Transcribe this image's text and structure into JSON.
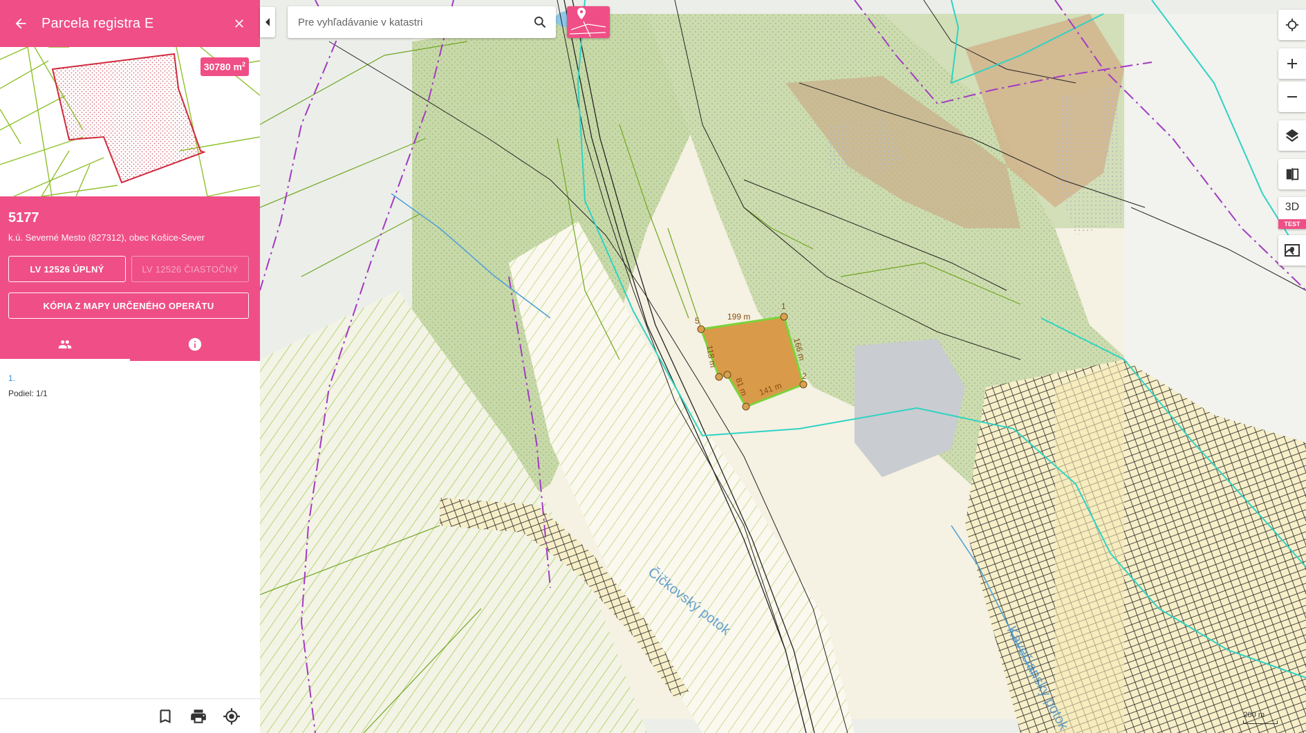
{
  "sidebar": {
    "title": "Parcela registra E",
    "area_value": "30780 m",
    "area_unit_sup": "2",
    "parcel_number": "5177",
    "location": "k.ú. Severné Mesto (827312), obec Košice-Sever",
    "btn_full": "LV 12526 ÚPLNÝ",
    "btn_partial": "LV 12526 ČIASTOČNÝ",
    "btn_copy": "KÓPIA Z MAPY URČENÉHO OPERÁTU",
    "tabs": [
      {
        "icon": "people-icon",
        "active": true
      },
      {
        "icon": "info-icon",
        "active": false
      }
    ],
    "owners": [
      {
        "index": "1.",
        "share": "Podiel: 1/1"
      }
    ],
    "bottom_icons": [
      "bookmark-icon",
      "print-icon",
      "locate-icon"
    ]
  },
  "map": {
    "search_placeholder": "Pre vyhľadávanie v katastri",
    "parcel_labels": {
      "side_top": "199 m",
      "side_right": "166 m",
      "side_bottom": "141 m",
      "side_left_inner": "81 m",
      "side_left": "118 m",
      "point_1": "1",
      "point_2": "2",
      "point_5": "5"
    },
    "stream_label_1": "Čičkovský potok",
    "stream_label_2": "Kavečiansky potok",
    "scale_label": "200 m",
    "controls": [
      "locate-icon",
      "zoom-in-icon",
      "zoom-out-icon",
      "layers-icon",
      "compare-icon",
      "3D",
      "street-view-icon"
    ],
    "three_d_label": "3D",
    "test_label": "TEST"
  },
  "colors": {
    "accent": "#ef4f86",
    "parcel_fill": "#d99a4a",
    "parcel_outline": "#7bd33a",
    "forest": "#c8d9a9",
    "boundary_cyan": "#2ed3c4",
    "boundary_purple": "#a23ac2"
  }
}
